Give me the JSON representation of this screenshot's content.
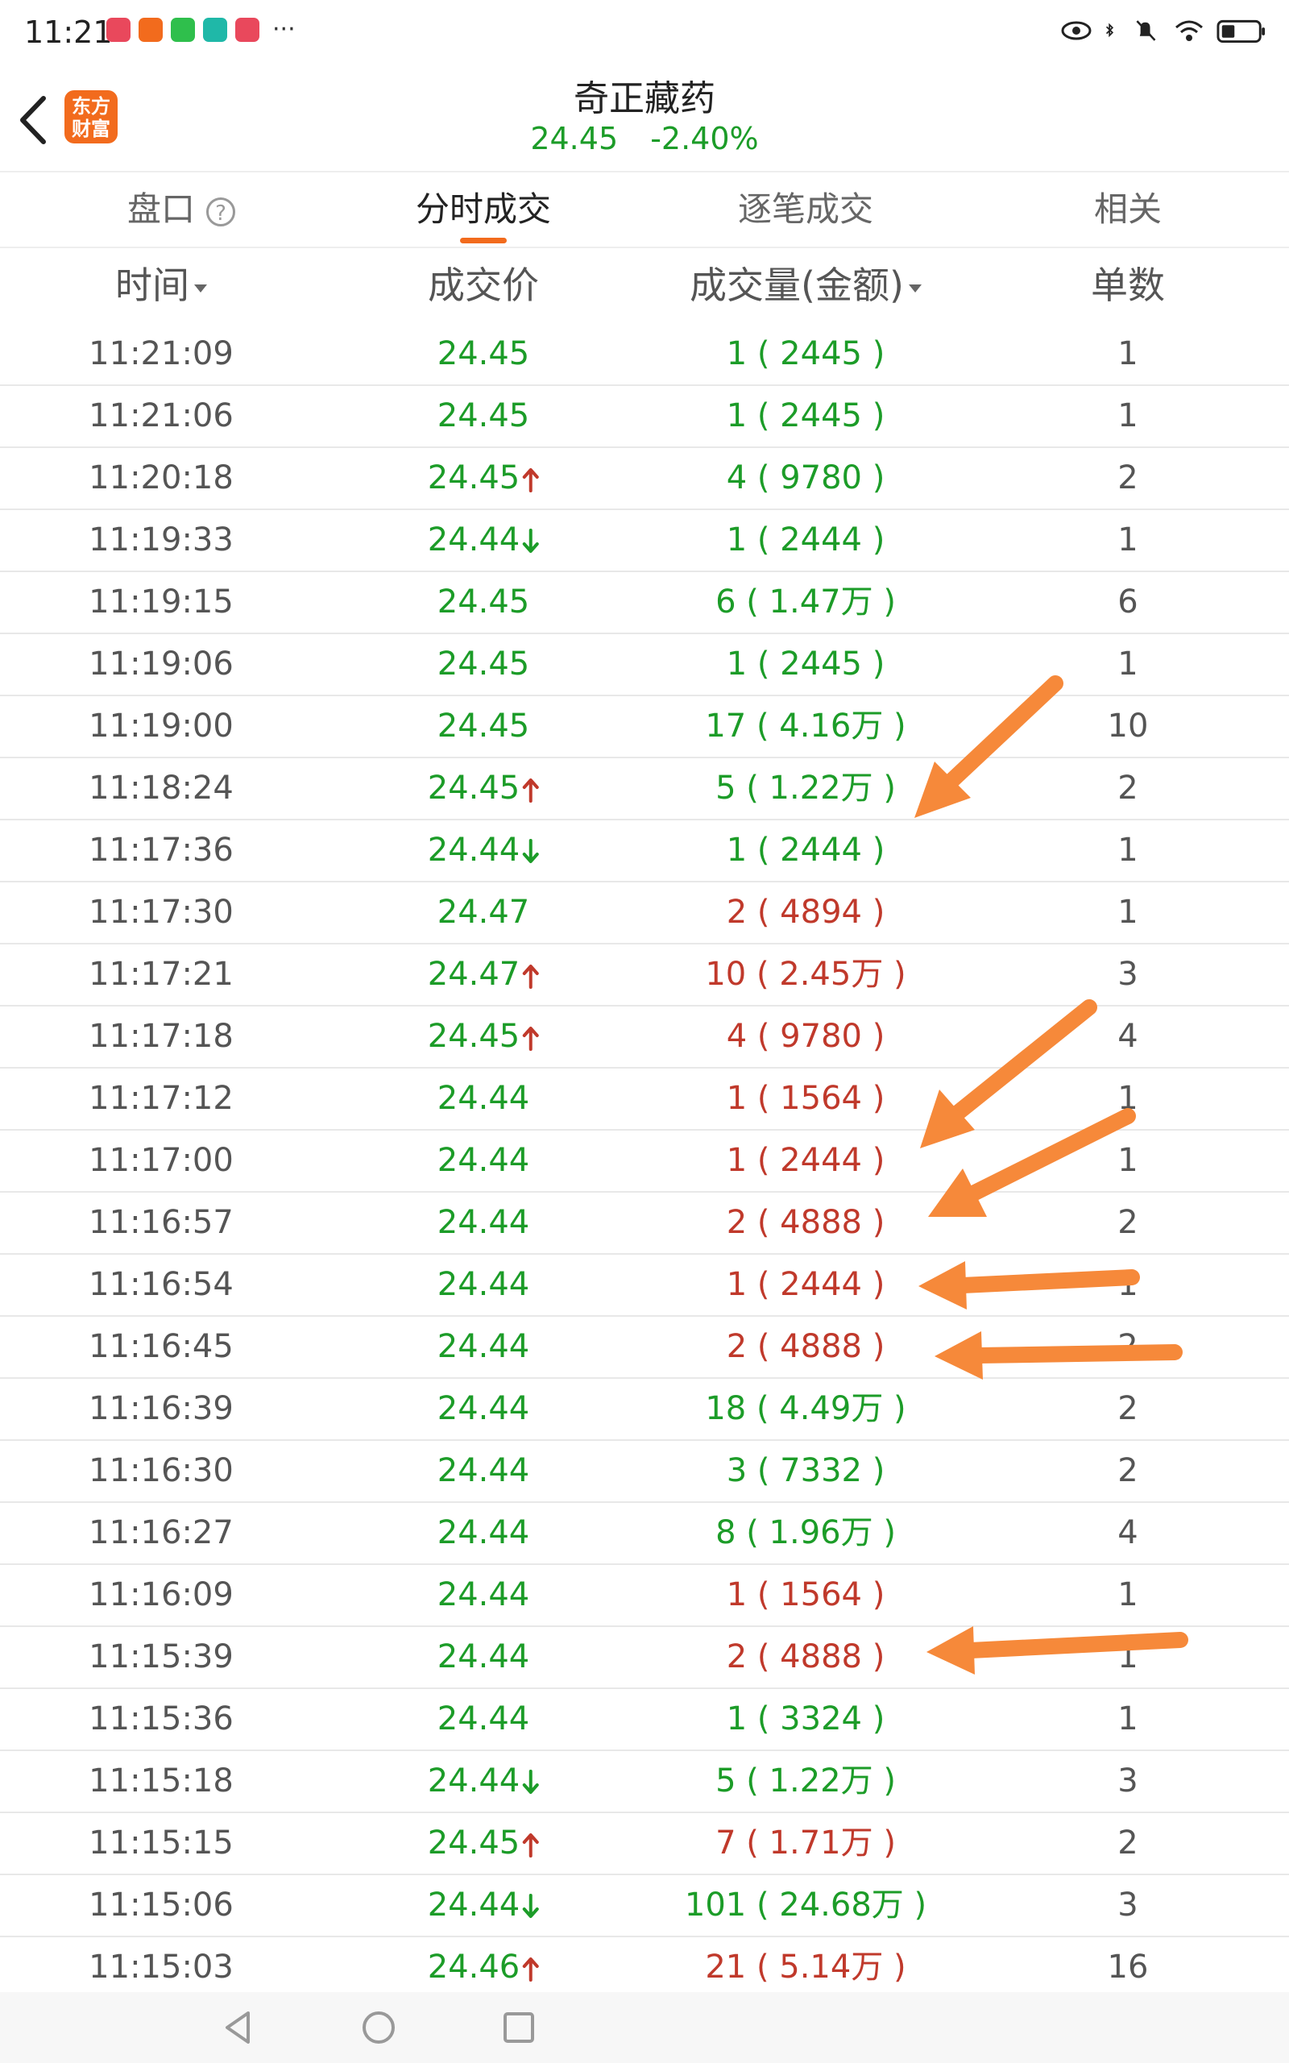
{
  "status": {
    "time": "11:21",
    "apps": [
      {
        "name": "app-icon-1",
        "color": "#e9485c"
      },
      {
        "name": "app-icon-2",
        "color": "#f26b1d"
      },
      {
        "name": "wechat-icon",
        "color": "#2fbf4c"
      },
      {
        "name": "app-icon-4",
        "color": "#1fb8a8"
      },
      {
        "name": "app-icon-5",
        "color": "#e9485c"
      }
    ],
    "more": "···"
  },
  "header": {
    "logo_text_line1": "东方",
    "logo_text_line2": "财富",
    "stock_name": "奇正藏药",
    "price": "24.45",
    "change_pct": "-2.40%"
  },
  "tabs": {
    "pankou": "盘口",
    "fenshi": "分时成交",
    "zhubi": "逐笔成交",
    "related": "相关"
  },
  "columns": {
    "time": "时间",
    "price": "成交价",
    "volume": "成交量(金额)",
    "count": "单数"
  },
  "colors": {
    "green": "#1c9c28",
    "red": "#c0392b",
    "accent": "#f26b1d",
    "annotation": "#f6893a"
  },
  "rows": [
    {
      "time": "11:21:09",
      "price": "24.45",
      "arrow": "",
      "volume": "1 ( 2445 )",
      "vol_color": "green",
      "count": "1"
    },
    {
      "time": "11:21:06",
      "price": "24.45",
      "arrow": "",
      "volume": "1 ( 2445 )",
      "vol_color": "green",
      "count": "1"
    },
    {
      "time": "11:20:18",
      "price": "24.45",
      "arrow": "up",
      "volume": "4 ( 9780 )",
      "vol_color": "green",
      "count": "2"
    },
    {
      "time": "11:19:33",
      "price": "24.44",
      "arrow": "down",
      "volume": "1 ( 2444 )",
      "vol_color": "green",
      "count": "1"
    },
    {
      "time": "11:19:15",
      "price": "24.45",
      "arrow": "",
      "volume": "6 ( 1.47万 )",
      "vol_color": "green",
      "count": "6"
    },
    {
      "time": "11:19:06",
      "price": "24.45",
      "arrow": "",
      "volume": "1 ( 2445 )",
      "vol_color": "green",
      "count": "1"
    },
    {
      "time": "11:19:00",
      "price": "24.45",
      "arrow": "",
      "volume": "17 ( 4.16万 )",
      "vol_color": "green",
      "count": "10"
    },
    {
      "time": "11:18:24",
      "price": "24.45",
      "arrow": "up",
      "volume": "5 ( 1.22万 )",
      "vol_color": "green",
      "count": "2"
    },
    {
      "time": "11:17:36",
      "price": "24.44",
      "arrow": "down",
      "volume": "1 ( 2444 )",
      "vol_color": "green",
      "count": "1"
    },
    {
      "time": "11:17:30",
      "price": "24.47",
      "arrow": "",
      "volume": "2 ( 4894 )",
      "vol_color": "red",
      "count": "1"
    },
    {
      "time": "11:17:21",
      "price": "24.47",
      "arrow": "up",
      "volume": "10 ( 2.45万 )",
      "vol_color": "red",
      "count": "3"
    },
    {
      "time": "11:17:18",
      "price": "24.45",
      "arrow": "up",
      "volume": "4 ( 9780 )",
      "vol_color": "red",
      "count": "4"
    },
    {
      "time": "11:17:12",
      "price": "24.44",
      "arrow": "",
      "volume": "1 ( 1564 )",
      "vol_color": "red",
      "count": "1"
    },
    {
      "time": "11:17:00",
      "price": "24.44",
      "arrow": "",
      "volume": "1 ( 2444 )",
      "vol_color": "red",
      "count": "1"
    },
    {
      "time": "11:16:57",
      "price": "24.44",
      "arrow": "",
      "volume": "2 ( 4888 )",
      "vol_color": "red",
      "count": "2"
    },
    {
      "time": "11:16:54",
      "price": "24.44",
      "arrow": "",
      "volume": "1 ( 2444 )",
      "vol_color": "red",
      "count": "1"
    },
    {
      "time": "11:16:45",
      "price": "24.44",
      "arrow": "",
      "volume": "2 ( 4888 )",
      "vol_color": "red",
      "count": "2"
    },
    {
      "time": "11:16:39",
      "price": "24.44",
      "arrow": "",
      "volume": "18 ( 4.49万 )",
      "vol_color": "green",
      "count": "2"
    },
    {
      "time": "11:16:30",
      "price": "24.44",
      "arrow": "",
      "volume": "3 ( 7332 )",
      "vol_color": "green",
      "count": "2"
    },
    {
      "time": "11:16:27",
      "price": "24.44",
      "arrow": "",
      "volume": "8 ( 1.96万 )",
      "vol_color": "green",
      "count": "4"
    },
    {
      "time": "11:16:09",
      "price": "24.44",
      "arrow": "",
      "volume": "1 ( 1564 )",
      "vol_color": "red",
      "count": "1"
    },
    {
      "time": "11:15:39",
      "price": "24.44",
      "arrow": "",
      "volume": "2 ( 4888 )",
      "vol_color": "red",
      "count": "1"
    },
    {
      "time": "11:15:36",
      "price": "24.44",
      "arrow": "",
      "volume": "1 ( 3324 )",
      "vol_color": "green",
      "count": "1"
    },
    {
      "time": "11:15:18",
      "price": "24.44",
      "arrow": "down",
      "volume": "5 ( 1.22万 )",
      "vol_color": "green",
      "count": "3"
    },
    {
      "time": "11:15:15",
      "price": "24.45",
      "arrow": "up",
      "volume": "7 ( 1.71万 )",
      "vol_color": "red",
      "count": "2"
    },
    {
      "time": "11:15:06",
      "price": "24.44",
      "arrow": "down",
      "volume": "101 ( 24.68万 )",
      "vol_color": "green",
      "count": "3"
    },
    {
      "time": "11:15:03",
      "price": "24.46",
      "arrow": "up",
      "volume": "21 ( 5.14万 )",
      "vol_color": "red",
      "count": "16"
    }
  ]
}
